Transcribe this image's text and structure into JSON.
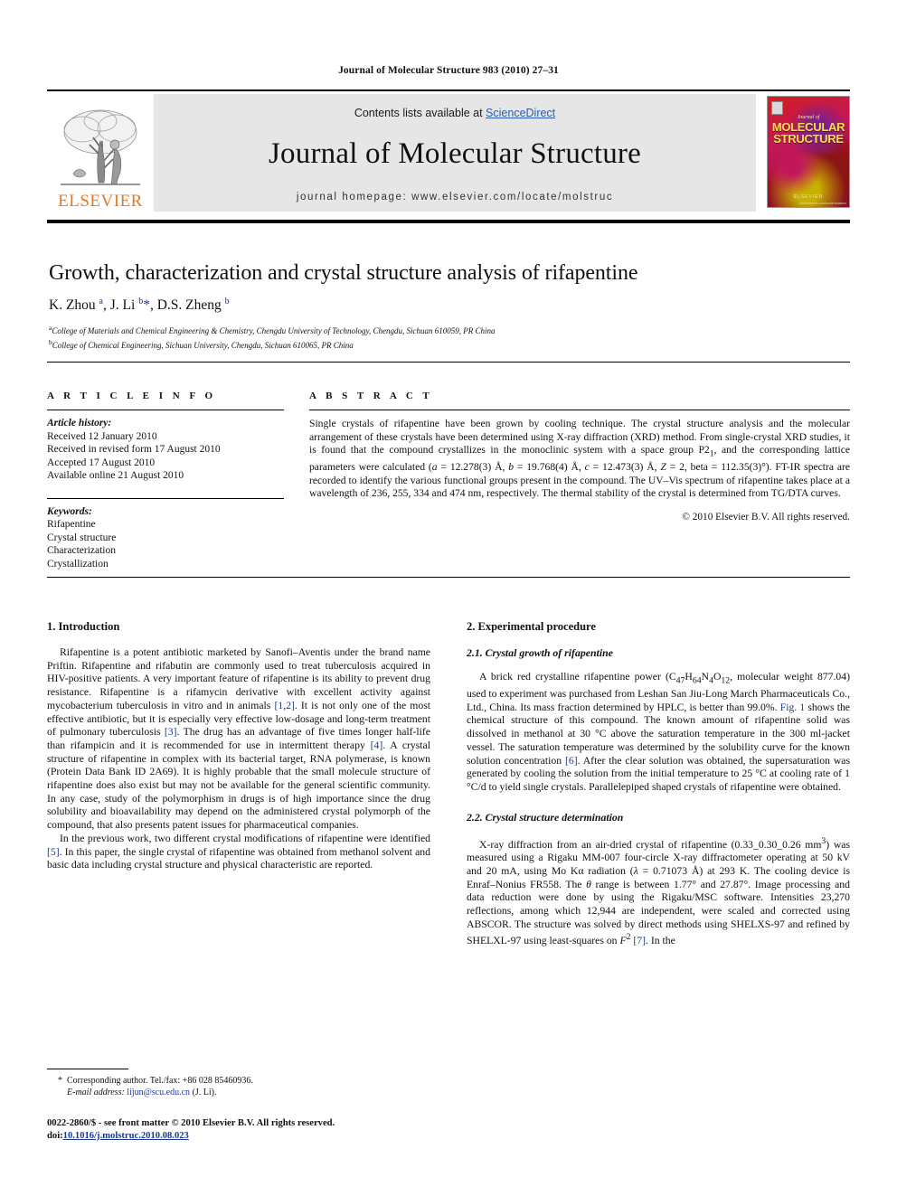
{
  "running_head": "Journal of Molecular Structure 983 (2010) 27–31",
  "masthead": {
    "contents_prefix": "Contents lists available at ",
    "sciencedirect": "ScienceDirect",
    "journal_title": "Journal of Molecular Structure",
    "homepage": "journal homepage: www.elsevier.com/locate/molstruc",
    "publisher_name": "ELSEVIER",
    "accent_orange": "#E87722",
    "link_blue": "#2a5db0",
    "band_gray": "#e6e6e6"
  },
  "cover": {
    "journal_of": "Journal of",
    "line1": "MOLECULAR",
    "line2": "STRUCTURE",
    "footer": "ELSEVIER",
    "footer_small": "www.elsevier.com/locate/molstruc"
  },
  "article": {
    "title": "Growth, characterization and crystal structure analysis of rifapentine",
    "authors_html": "K. Zhou <sup>a</sup>, J. Li <sup>b</sup><span class=\"star\">*</span>, D.S. Zheng <sup>b</sup>",
    "affiliation_a": "College of Materials and Chemical Engineering & Chemistry, Chengdu University of Technology, Chengdu, Sichuan 610059, PR China",
    "affiliation_b": "College of Chemical Engineering, Sichuan University, Chengdu, Sichuan 610065, PR China"
  },
  "article_info": {
    "heading": "A R T I C L E   I N F O",
    "history_label": "Article history:",
    "history": [
      "Received 12 January 2010",
      "Received in revised form 17 August 2010",
      "Accepted 17 August 2010",
      "Available online 21 August 2010"
    ],
    "keywords_label": "Keywords:",
    "keywords": [
      "Rifapentine",
      "Crystal structure",
      "Characterization",
      "Crystallization"
    ]
  },
  "abstract": {
    "heading": "A B S T R A C T",
    "text_html": "Single crystals of rifapentine have been grown by cooling technique. The crystal structure analysis and the molecular arrangement of these crystals have been determined using X-ray diffraction (XRD) method. From single-crystal XRD studies, it is found that the compound crystallizes in the monoclinic system with a space group P2<sub>1</sub>, and the corresponding lattice parameters were calculated (<i>a</i> = 12.278(3) Å, <i>b</i> = 19.768(4) Å, <i>c</i> = 12.473(3) Å, <i>Z</i> = 2, beta = 112.35(3)°). FT-IR spectra are recorded to identify the various functional groups present in the compound. The UV–Vis spectrum of rifapentine takes place at a wavelength of 236, 255, 334 and 474 nm, respectively. The thermal stability of the crystal is determined from TG/DTA curves.",
    "copyright": "© 2010 Elsevier B.V. All rights reserved."
  },
  "body": {
    "section1_heading": "1. Introduction",
    "intro_p1_html": "Rifapentine is a potent antibiotic marketed by Sanofi–Aventis under the brand name Priftin. Rifapentine and rifabutin are commonly used to treat tuberculosis acquired in HIV-positive patients. A very important feature of rifapentine is its ability to prevent drug resistance. Rifapentine is a rifamycin derivative with excellent activity against mycobacterium tuberculosis in vitro and in animals <span class=\"ref\">[1,2]</span>. It is not only one of the most effective antibiotic, but it is especially very effective low-dosage and long-term treatment of pulmonary tuberculosis <span class=\"ref\">[3]</span>. The drug has an advantage of five times longer half-life than rifampicin and it is recommended for use in intermittent therapy <span class=\"ref\">[4]</span>. A crystal structure of rifapentine in complex with its bacterial target, RNA polymerase, is known (Protein Data Bank ID 2A69). It is highly probable that the small molecule structure of rifapentine does also exist but may not be available for the general scientific community. In any case, study of the polymorphism in drugs is of high importance since the drug solubility and bioavailability may depend on the administered crystal polymorph of the compound, that also presents patent issues for pharmaceutical companies.",
    "intro_p2_html": "In the previous work, two different crystal modifications of rifapentine were identified <span class=\"ref\">[5]</span>. In this paper, the single crystal of rifapentine was obtained from methanol solvent and basic data including crystal structure and physical characteristic are reported.",
    "section2_heading": "2. Experimental procedure",
    "section21_heading": "2.1. Crystal growth of rifapentine",
    "sec21_p1_html": "A brick red crystalline rifapentine power (C<sub>47</sub>H<sub>64</sub>N<sub>4</sub>O<sub>12</sub>, molecular weight 877.04) used to experiment was purchased from Leshan San Jiu-Long March Pharmaceuticals Co., Ltd., China. Its mass fraction determined by HPLC, is better than 99.0%. <span class=\"ref\">Fig. 1</span> shows the chemical structure of this compound. The known amount of rifapentine solid was dissolved in methanol at 30 °C above the saturation temperature in the 300 ml-jacket vessel. The saturation temperature was determined by the solubility curve for the known solution concentration <span class=\"ref\">[6]</span>. After the clear solution was obtained, the supersaturation was generated by cooling the solution from the initial temperature to 25 °C at cooling rate of 1 °C/d to yield single crystals. Parallelepiped shaped crystals of rifapentine were obtained.",
    "section22_heading": "2.2. Crystal structure determination",
    "sec22_p1_html": "X-ray diffraction from an air-dried crystal of rifapentine (0.33_0.30_0.26 mm<sup>3</sup>) was measured using a Rigaku MM-007 four-circle X-ray diffractometer operating at 50 kV and 20 mA, using Mo Kα radiation (<i>λ</i> = 0.71073 Å) at 293 K. The cooling device is Enraf–Nonius FR558. The <i>θ</i> range is between 1.77° and 27.87°. Image processing and data reduction were done by using the Rigaku/MSC software. Intensities 23,270 reflections, among which 12,944 are independent, were scaled and corrected using ABSCOR. The structure was solved by direct methods using SHELXS-97 and refined by SHELXL-97 using least-squares on <i>F</i><sup>2</sup> <span class=\"ref\">[7]</span>. In the"
  },
  "footer": {
    "corresponding_html": "* &nbsp;Corresponding author. Tel./fax: +86 028 85460936.",
    "email_label": "E-mail address:",
    "email": "lijun@scu.edu.cn",
    "email_suffix": "(J. Li).",
    "issn_line_html": "0022-2860/$ - see front matter © 2010 Elsevier B.V. All rights reserved.",
    "doi_prefix": "doi:",
    "doi": "10.1016/j.molstruc.2010.08.023"
  }
}
